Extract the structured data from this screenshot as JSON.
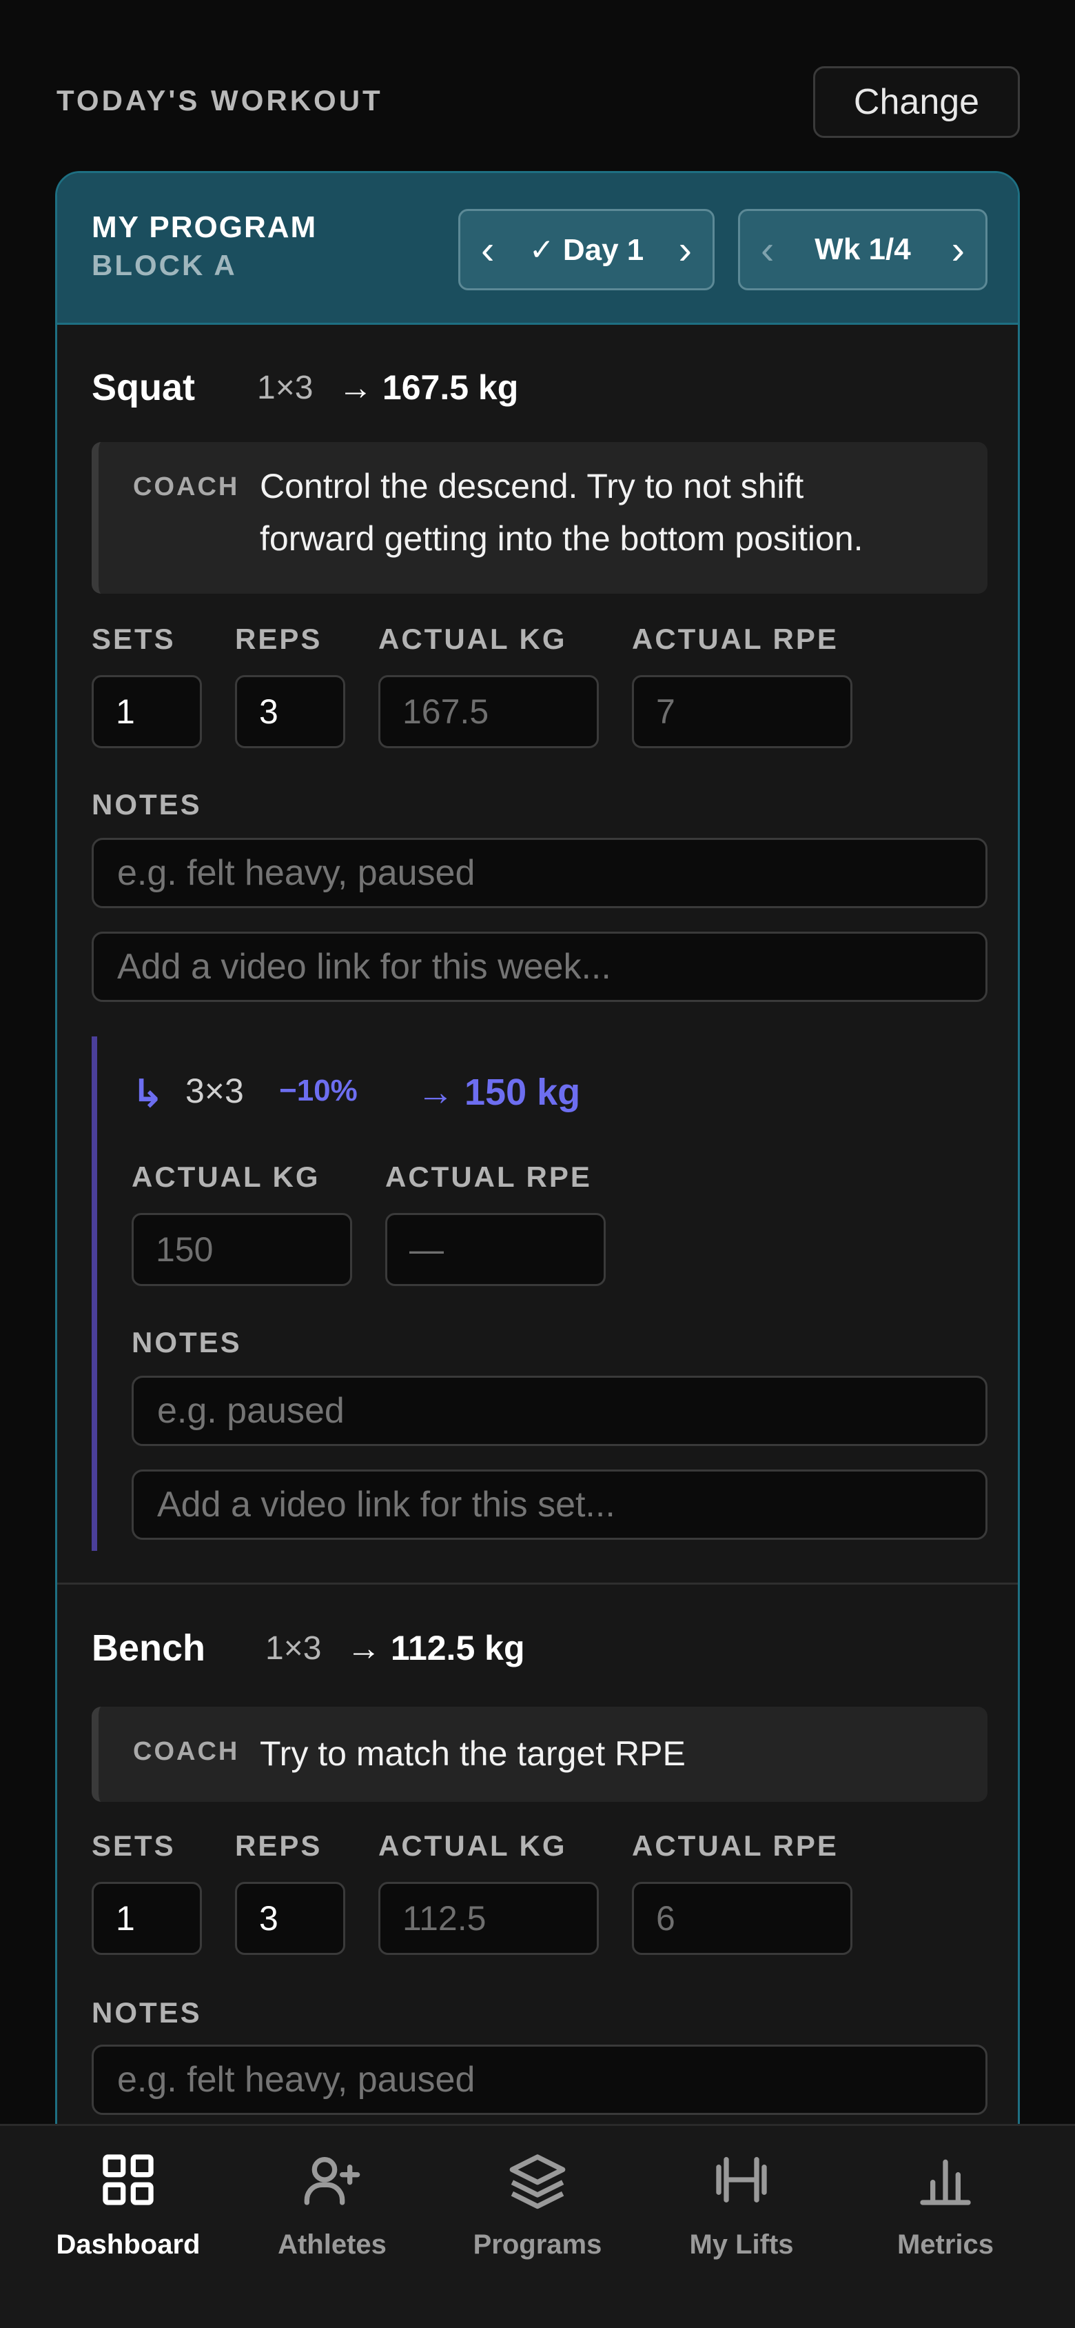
{
  "header": {
    "title": "TODAY'S WORKOUT",
    "change_label": "Change"
  },
  "program": {
    "name": "MY PROGRAM",
    "block": "BLOCK A",
    "day": {
      "prev": "‹",
      "label": "✓ Day 1",
      "next": "›"
    },
    "week": {
      "prev": "‹",
      "label": "Wk 1/4",
      "next": "›"
    }
  },
  "labels": {
    "coach": "COACH",
    "sets": "SETS",
    "reps": "REPS",
    "actual_kg": "ACTUAL KG",
    "actual_rpe": "ACTUAL RPE",
    "notes": "NOTES"
  },
  "exercises": [
    {
      "name": "Squat",
      "scheme": "1×3",
      "target": "→ 167.5 kg",
      "coach_note_line1": "Control the descend. Try to not shift",
      "coach_note_line2": "forward getting into the bottom position.",
      "sets": "1",
      "reps": "3",
      "actual_kg_placeholder": "167.5",
      "actual_rpe_placeholder": "7",
      "notes_placeholder": "e.g. felt heavy, paused",
      "video_placeholder": "Add a video link for this week...",
      "backoff": {
        "arrow": "↳",
        "scheme": "3×3",
        "percent": "−10%",
        "target": "→ 150 kg",
        "actual_kg_placeholder": "150",
        "actual_rpe_placeholder": "—",
        "notes_placeholder": "e.g. paused",
        "video_placeholder": "Add a video link for this set..."
      }
    },
    {
      "name": "Bench",
      "scheme": "1×3",
      "target": "→ 112.5 kg",
      "coach_note": "Try to match the target RPE",
      "sets": "1",
      "reps": "3",
      "actual_kg_placeholder": "112.5",
      "actual_rpe_placeholder": "6",
      "notes_placeholder": "e.g. felt heavy, paused"
    }
  ],
  "nav": [
    {
      "label": "Dashboard",
      "icon": "grid-icon",
      "active": true
    },
    {
      "label": "Athletes",
      "icon": "user-plus-icon",
      "active": false
    },
    {
      "label": "Programs",
      "icon": "layers-icon",
      "active": false
    },
    {
      "label": "My Lifts",
      "icon": "barbell-icon",
      "active": false
    },
    {
      "label": "Metrics",
      "icon": "bar-chart-icon",
      "active": false
    }
  ],
  "colors": {
    "accent_teal": "#1e6f82",
    "header_bg": "#1b4e5e",
    "backoff_accent": "#6d6ef0"
  }
}
